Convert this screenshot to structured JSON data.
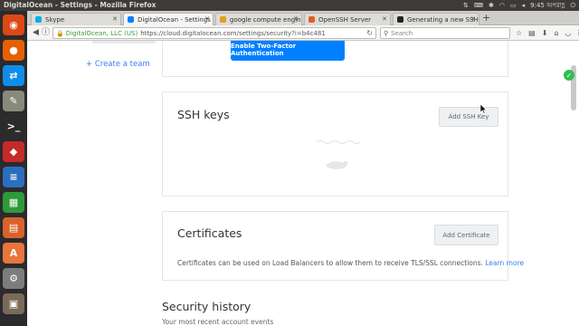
{
  "window": {
    "title": "DigitalOcean - Settings - Mozilla Firefox"
  },
  "system_tray": {
    "clock": "9:45 অপরাহ্ণ"
  },
  "launcher": {
    "items": [
      {
        "name": "ubuntu-dash-icon",
        "glyph": "◉",
        "color": "#dd4814"
      },
      {
        "name": "firefox-icon",
        "glyph": "●",
        "color": "#e66000"
      },
      {
        "name": "teamviewer-icon",
        "glyph": "⇄",
        "color": "#0e8ee9"
      },
      {
        "name": "text-editor-icon",
        "glyph": "✎",
        "color": "#8a8a7a"
      },
      {
        "name": "terminal-icon",
        "glyph": ">_",
        "color": "#2c2c2c"
      },
      {
        "name": "ruby-icon",
        "glyph": "◆",
        "color": "#c52a2a"
      },
      {
        "name": "writer-icon",
        "glyph": "≡",
        "color": "#2a6ec0"
      },
      {
        "name": "calc-icon",
        "glyph": "▦",
        "color": "#2f9a3a"
      },
      {
        "name": "impress-icon",
        "glyph": "▤",
        "color": "#d9612b"
      },
      {
        "name": "software-center-icon",
        "glyph": "A",
        "color": "#e8753a"
      },
      {
        "name": "settings-icon",
        "glyph": "⚙",
        "color": "#7c7c7c"
      },
      {
        "name": "trash-icon",
        "glyph": "▣",
        "color": "#7a6a5a"
      }
    ]
  },
  "tabs": [
    {
      "label": "Skype",
      "color": "#00aff0",
      "active": false
    },
    {
      "label": "DigitalOcean - Settings",
      "color": "#0080ff",
      "active": true
    },
    {
      "label": "google compute engin",
      "color": "#e0a020",
      "active": false
    },
    {
      "label": "OpenSSH Server",
      "color": "#e06020",
      "active": false
    },
    {
      "label": "Generating a new SSH k",
      "color": "#222222",
      "active": false
    }
  ],
  "navbar": {
    "org": "DigitalOcean, LLC (US)",
    "url": "https://cloud.digitalocean.com/settings/security?i=b4c481",
    "search_placeholder": "Search"
  },
  "sidebar": {
    "create_team": "+ Create a team"
  },
  "two_factor": {
    "button_label": "Enable Two-Factor Authentication"
  },
  "ssh_keys": {
    "title": "SSH keys",
    "add_button": "Add SSH Key"
  },
  "certificates": {
    "title": "Certificates",
    "add_button": "Add Certificate",
    "description": "Certificates can be used on Load Balancers to allow them to receive TLS/SSL connections.",
    "learn_more": "Learn more"
  },
  "security_history": {
    "title": "Security history",
    "subtitle": "Your most recent account events"
  },
  "colors": {
    "accent": "#0080ff",
    "link": "#3b7ff2",
    "ubuntu_panel": "#3c3b37"
  }
}
